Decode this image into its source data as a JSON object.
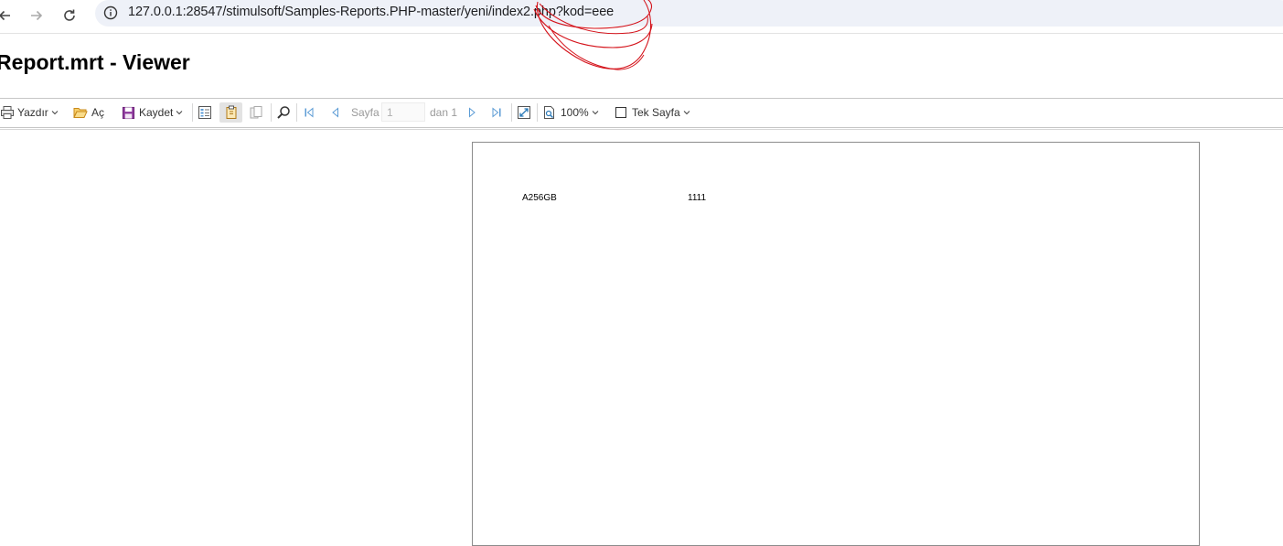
{
  "browser": {
    "url_host": "127.0.0.1",
    "url_path": ":28547/stimulsoft/Samples-Reports.PHP-master/yeni/index2.php?kod=eee"
  },
  "page": {
    "title": "Report.mrt - Viewer"
  },
  "toolbar": {
    "print_label": "Yazdır",
    "open_label": "Aç",
    "save_label": "Kaydet",
    "page_label": "Sayfa",
    "page_value": "1",
    "of_label": "dan 1",
    "zoom_label": "100%",
    "view_mode_label": "Tek Sayfa"
  },
  "report": {
    "rows": [
      {
        "code": "A256GB",
        "value": "1111"
      }
    ]
  },
  "colors": {
    "annotation_scribble": "#d4121a",
    "nav_icon_blue": "#5b9bd5",
    "save_icon_purple": "#8e3a9d",
    "open_icon_yellow": "#e8a33d"
  }
}
